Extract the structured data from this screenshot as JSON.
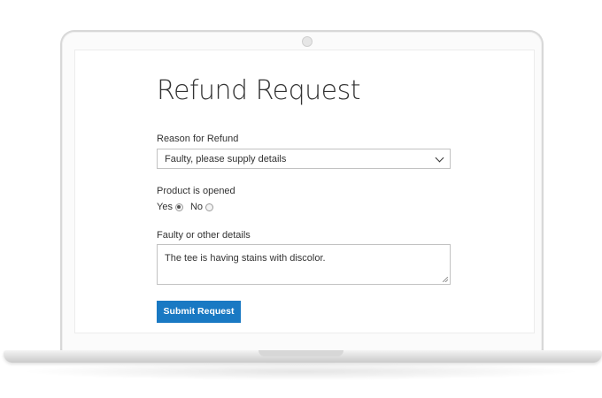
{
  "form": {
    "title": "Refund Request",
    "reason_label": "Reason for Refund",
    "reason_selected": "Faulty, please supply details",
    "opened_label": "Product is opened",
    "opened_options": [
      "Yes",
      "No"
    ],
    "opened_selected": "Yes",
    "details_label": "Faulty or other details",
    "details_value": "The tee is having stains with discolor.",
    "submit_label": "Submit Request"
  },
  "colors": {
    "accent": "#1979c3",
    "text": "#333333",
    "border": "#c2c2c2"
  }
}
